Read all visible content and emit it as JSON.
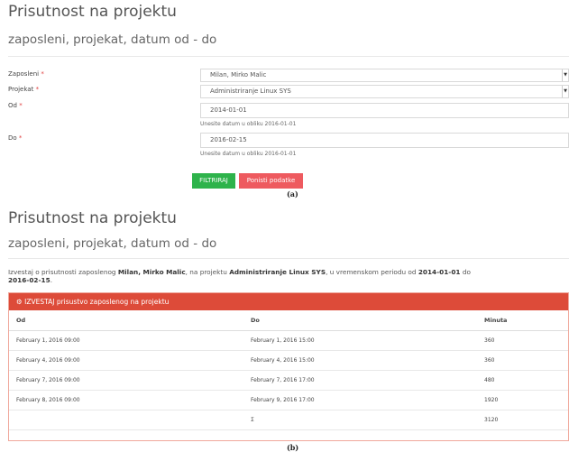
{
  "form": {
    "title": "Prisutnost na projektu",
    "subtitle": "zaposleni, projekat, datum od - do",
    "employee_label": "Zaposleni",
    "employee_value": "Milan, Mirko Malic",
    "project_label": "Projekat",
    "project_value": "Administriranje Linux SYS",
    "from_label": "Od",
    "from_value": "2014-01-01",
    "from_hint": "Unesite datum u obliku 2016-01-01",
    "to_label": "Do",
    "to_value": "2016-02-15",
    "to_hint": "Unesite datum u obliku 2016-01-01",
    "required_mark": "*",
    "filter_button": "FILTRIRAJ",
    "reset_button": "Ponisti podatke",
    "caption": "(a)"
  },
  "report": {
    "title": "Prisutnost na projektu",
    "subtitle": "zaposleni, projekat, datum od - do",
    "summary_prefix": "Izvestaj o prisutnosti zaposlenog ",
    "summary_employee": "Milan, Mirko Malic",
    "summary_mid1": ", na projektu ",
    "summary_project": "Administriranje Linux SYS",
    "summary_mid2": ", u vremenskom periodu od ",
    "summary_from": "2014-01-01",
    "summary_mid3": " do",
    "summary_to": "2016-02-15",
    "summary_end": ".",
    "panel_title": "IZVESTAJ prisustvo zaposlenog na projektu",
    "panel_icon": "cogs-icon",
    "columns": [
      "Od",
      "Do",
      "Minuta"
    ],
    "rows": [
      [
        "February 1, 2016 09:00",
        "February 1, 2016 15:00",
        "360"
      ],
      [
        "February 4, 2016 09:00",
        "February 4, 2016 15:00",
        "360"
      ],
      [
        "February 7, 2016 09:00",
        "February 7, 2016 17:00",
        "480"
      ],
      [
        "February 8, 2016 09:00",
        "February 9, 2016 17:00",
        "1920"
      ]
    ],
    "total_symbol": "Σ",
    "total_value": "3120",
    "caption": "(b)"
  },
  "colors": {
    "green": "#2eb34b",
    "red_button": "#ee5a5f",
    "panel_red": "#dd4b39"
  }
}
